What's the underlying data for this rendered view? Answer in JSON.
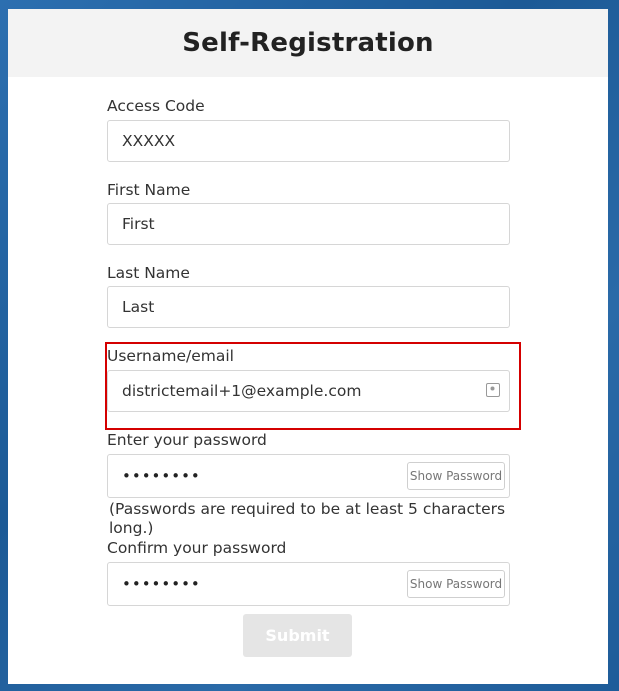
{
  "page": {
    "title": "Self-Registration"
  },
  "form": {
    "access_code": {
      "label": "Access Code",
      "value": "XXXXX"
    },
    "first_name": {
      "label": "First Name",
      "value": "First"
    },
    "last_name": {
      "label": "Last Name",
      "value": "Last"
    },
    "username": {
      "label": "Username/email",
      "value": "districtemail+1@example.com"
    },
    "password": {
      "label": "Enter your password",
      "masked": "••••••••",
      "show_label": "Show Password"
    },
    "password_note": "(Passwords are required to be at least 5 characters long.)",
    "confirm_password": {
      "label": "Confirm your password",
      "masked": "••••••••",
      "show_label": "Show Password"
    },
    "submit_label": "Submit"
  },
  "colors": {
    "highlight": "#d40000",
    "frame": "#1f5f9e",
    "header_bg": "#f3f3f3",
    "submit_disabled": "#e5e5e5"
  },
  "icons": {
    "autofill": "contact-card-icon"
  }
}
